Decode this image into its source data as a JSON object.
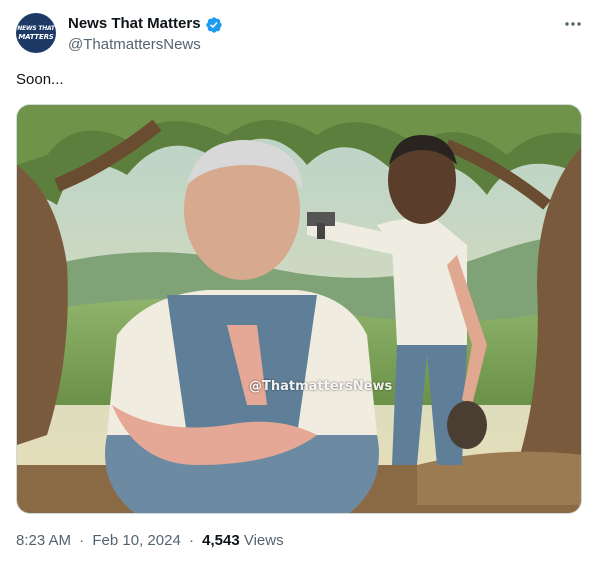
{
  "author": {
    "display_name": "News That Matters",
    "handle": "@ThatmattersNews",
    "avatar_line1": "NEWS THAT",
    "avatar_line2": "MATTERS",
    "verified": true
  },
  "tweet": {
    "text": "Soon...",
    "media_watermark": "@ThatmattersNews"
  },
  "meta": {
    "time": "8:23 AM",
    "date": "Feb 10, 2024",
    "separator": "·",
    "views_count": "4,543",
    "views_label": "Views"
  },
  "icons": {
    "verified": "verified-badge-icon",
    "more": "more-horizontal-icon"
  },
  "colors": {
    "verified_blue": "#1d9bf0",
    "secondary_text": "#536471",
    "primary_text": "#0f1419",
    "avatar_bg": "#1d3a66"
  }
}
